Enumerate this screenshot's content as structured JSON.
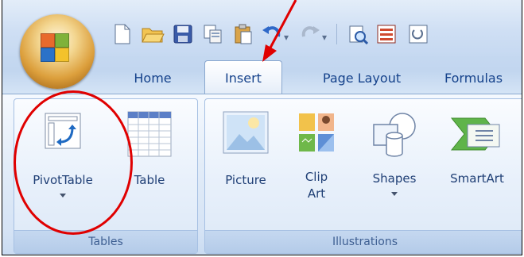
{
  "tabs": [
    {
      "label": "Home"
    },
    {
      "label": "Insert",
      "active": true
    },
    {
      "label": "Page Layout"
    },
    {
      "label": "Formulas"
    }
  ],
  "groups": {
    "tables": {
      "label": "Tables",
      "commands": [
        {
          "label": "PivotTable",
          "has_dropdown": true
        },
        {
          "label": "Table"
        }
      ]
    },
    "illustrations": {
      "label": "Illustrations",
      "commands": [
        {
          "label": "Picture"
        },
        {
          "label": "Clip Art",
          "lines": [
            "Clip",
            "Art"
          ]
        },
        {
          "label": "Shapes",
          "has_dropdown": true
        },
        {
          "label": "SmartArt"
        }
      ]
    }
  },
  "annotations": {
    "arrow_color": "#e00000",
    "circle_color": "#e00000"
  },
  "colors": {
    "tab_text": "#15428b",
    "group_label_text": "#3e5f92"
  }
}
